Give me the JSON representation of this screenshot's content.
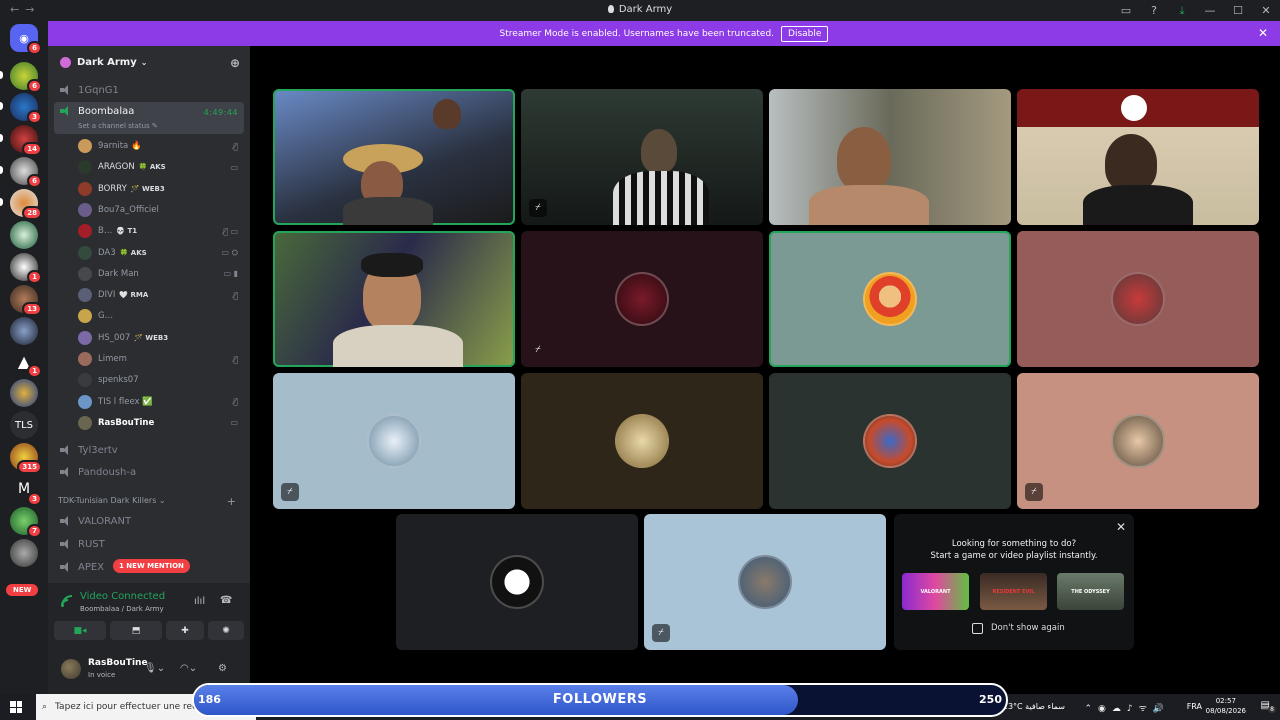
{
  "window": {
    "title": "Dark Army"
  },
  "banner": {
    "text": "Streamer Mode is enabled. Usernames have been truncated.",
    "button": "Disable"
  },
  "rail": {
    "servers": [
      {
        "name": "discord-home",
        "badge": "6"
      },
      {
        "name": "server-1",
        "badge": "6"
      },
      {
        "name": "server-2",
        "badge": "3"
      },
      {
        "name": "server-3",
        "badge": "14"
      },
      {
        "name": "server-4",
        "badge": "6"
      },
      {
        "name": "server-5",
        "badge": "28"
      },
      {
        "name": "server-6",
        "badge": ""
      },
      {
        "name": "server-7",
        "badge": "1"
      },
      {
        "name": "server-8",
        "badge": "13"
      },
      {
        "name": "server-9",
        "badge": ""
      },
      {
        "name": "server-10",
        "badge": "1"
      },
      {
        "name": "server-11",
        "badge": ""
      },
      {
        "name": "server-tls",
        "text": "TLS",
        "badge": ""
      },
      {
        "name": "server-13",
        "badge": "315"
      },
      {
        "name": "server-14",
        "badge": "3"
      },
      {
        "name": "server-15",
        "badge": "7"
      },
      {
        "name": "server-16",
        "badge": "5"
      }
    ],
    "new_label": "NEW"
  },
  "sidebar": {
    "guild_name": "Dark Army",
    "channels_top": [
      {
        "name": "1GqnG1"
      }
    ],
    "active_channel": {
      "name": "Boombalaa",
      "timer": "4:49:44",
      "status": "Set a channel status ✎"
    },
    "members": [
      {
        "name": "9arnita 🔥",
        "tag": "",
        "color": "#c99a5a"
      },
      {
        "name": "ARAGON",
        "tag": "🍀 AKS",
        "color": "#2a3a2c"
      },
      {
        "name": "BORRY",
        "tag": "🪄 WEB3",
        "color": "#8e3b2a"
      },
      {
        "name": "Bou7a_Officiel",
        "tag": "",
        "color": "#6a5d8a"
      },
      {
        "name": "B…",
        "tag": "💀 T1",
        "color": "#a41e2a"
      },
      {
        "name": "DA3",
        "tag": "🍀 AKS",
        "color": "#324b3d"
      },
      {
        "name": "Dark Man",
        "tag": "",
        "color": "#47484d"
      },
      {
        "name": "DIVI",
        "tag": "🤍 RMA",
        "color": "#5a5f77"
      },
      {
        "name": "G…",
        "tag": "",
        "color": "#c8a44a"
      },
      {
        "name": "HS_007",
        "tag": "🪄 WEB3",
        "color": "#7b6aa5"
      },
      {
        "name": "Limem",
        "tag": "",
        "color": "#9a6b5b"
      },
      {
        "name": "spenks07",
        "tag": "",
        "color": "#3a3b40"
      },
      {
        "name": "TIS l fleex ✅",
        "tag": "",
        "color": "#6c95c8"
      },
      {
        "name": "RasBouTine",
        "tag": "",
        "color": "#6a6550"
      }
    ],
    "channels_bottom": [
      {
        "name": "Tyl3ertv"
      },
      {
        "name": "Pandoush-a"
      }
    ],
    "category": "TDK-Tunisian Dark Killers",
    "category_channels": [
      {
        "name": "VALORANT"
      },
      {
        "name": "RUST"
      },
      {
        "name": "APEX"
      }
    ],
    "mention_badge": "1 NEW MENTION"
  },
  "voice": {
    "title": "Video Connected",
    "subtitle": "Boombalaa / Dark Army",
    "user": {
      "name": "RasBouTine",
      "status": "In voice"
    }
  },
  "suggest": {
    "line1": "Looking for something to do?",
    "line2": "Start a game or video playlist instantly.",
    "thumbs": [
      "VALORANT",
      "RESIDENT EVIL",
      "THE ODYSSEY"
    ],
    "checkbox": "Don't show again"
  },
  "taskbar": {
    "search_placeholder": "Tapez ici pour effectuer une recherche",
    "weather": "23°C  سماء صافية",
    "lang": "FRA",
    "time": "02:57",
    "date": "08/08/2026",
    "notif_count": "8"
  },
  "followers": {
    "label": "FOLLOWERS",
    "current": "186",
    "goal": "250"
  }
}
